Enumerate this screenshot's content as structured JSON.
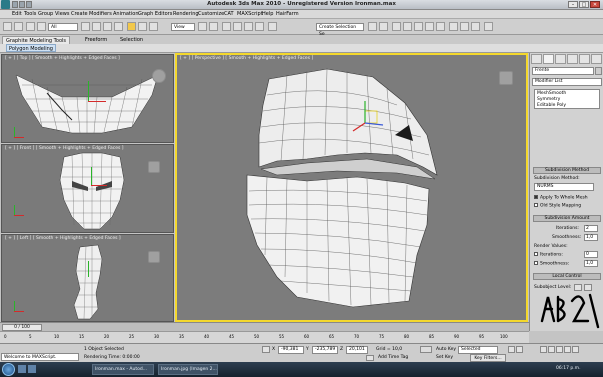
{
  "window": {
    "title": "Autodesk 3ds Max 2010 - Unregistered Version  Ironman.max",
    "buttons": {
      "minimize": "–",
      "maximize": "□",
      "close": "✕"
    }
  },
  "menu": [
    "Edit",
    "Tools",
    "Group",
    "Views",
    "Create",
    "Modifiers",
    "Animation",
    "Graph Editors",
    "Rendering",
    "Customize",
    "CAT",
    "MAXScript",
    "Help",
    "HairFarm"
  ],
  "toolbar": {
    "selection_filter": "All",
    "ref_coord": "View",
    "named_selection": "Create Selection Se"
  },
  "ribbon": {
    "tabs": [
      "Graphite Modeling Tools",
      "Freeform",
      "Selection"
    ],
    "active_tab": 0,
    "panel_label": "Polygon Modeling"
  },
  "viewports": {
    "top": "[ + ] [ Top ] [ Smooth + Highlights + Edged Faces ]",
    "front": "[ + ] [ Front ] [ Smooth + Highlights + Edged Faces ]",
    "left": "[ + ] [ Left ] [ Smooth + Highlights + Edged Faces ]",
    "perspective": "[ + ] [ Perspective ] [ Smooth + Highlights + Edged Faces ]"
  },
  "command_panel": {
    "object_name": "Frente",
    "modifier_list_label": "Modifier List",
    "stack": [
      "MeshSmooth",
      "Symmetry",
      "Editable Poly"
    ],
    "subdivision_method": {
      "header": "Subdivision Method",
      "method_label": "Subdivision Method:",
      "method_value": "NURMS",
      "apply_whole_mesh": "Apply To Whole Mesh",
      "old_style_mapping": "Old Style Mapping"
    },
    "subdivision_amount": {
      "header": "Subdivision Amount",
      "iterations_label": "Iterations:",
      "iterations_value": "2",
      "smoothness_label": "Smoothness:",
      "smoothness_value": "1,0",
      "render_values": "Render Values:",
      "render_iterations_label": "Iterations:",
      "render_iterations_value": "0",
      "render_smoothness_label": "Smoothness:",
      "render_smoothness_value": "1,0"
    },
    "local_control": {
      "header": "Local Control",
      "subobject_level": "Subobject Level:"
    }
  },
  "timeline": {
    "frame_readout": "0 / 100",
    "ticks": [
      "0",
      "5",
      "10",
      "15",
      "20",
      "25",
      "30",
      "35",
      "40",
      "45",
      "50",
      "55",
      "60",
      "65",
      "70",
      "75",
      "80",
      "85",
      "90",
      "95",
      "100"
    ]
  },
  "status": {
    "maxscript": "Welcome to MAXScript.",
    "selection": "1 Object Selected",
    "render_time": "Rendering Time: 0:00:00",
    "x": "-90,381",
    "y": "-235,789",
    "z": "20,101",
    "grid": "Grid = 10,0",
    "add_time_tag": "Add Time Tag",
    "auto_key": "Auto Key",
    "set_key": "Set Key",
    "key_mode": "Selected",
    "key_filters": "Key Filters..."
  },
  "taskbar": {
    "items": [
      "Ironman.max - Autod...",
      "Ironman.jpg (Imagen 2..."
    ],
    "clock": "06:17 p.m."
  },
  "colors": {
    "active_viewport": "#f4d82c",
    "viewport_bg": "#7a7a7a"
  }
}
